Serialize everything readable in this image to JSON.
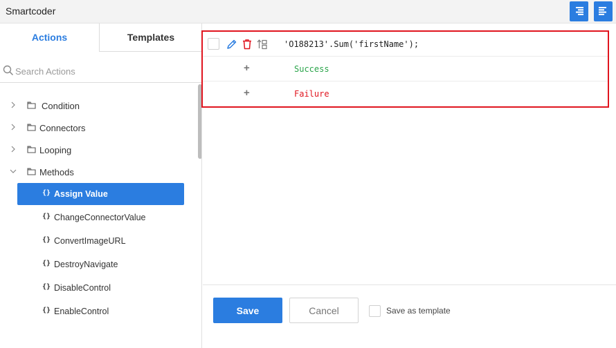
{
  "header": {
    "title": "Smartcoder",
    "buttons": [
      {
        "icon": "align-right-icon"
      },
      {
        "icon": "align-left-icon"
      }
    ]
  },
  "left_panel": {
    "tabs": [
      {
        "label": "Actions",
        "active": true
      },
      {
        "label": "Templates",
        "active": false
      }
    ],
    "search": {
      "placeholder": "Search Actions",
      "value": ""
    },
    "folders": [
      {
        "label": "Condition",
        "expanded": false
      },
      {
        "label": "Connectors",
        "expanded": false
      },
      {
        "label": "Looping",
        "expanded": false
      },
      {
        "label": "Methods",
        "expanded": true
      }
    ],
    "methods": [
      {
        "label": "Assign Value",
        "active": true
      },
      {
        "label": "ChangeConnectorValue",
        "active": false
      },
      {
        "label": "ConvertImageURL",
        "active": false
      },
      {
        "label": "DestroyNavigate",
        "active": false
      },
      {
        "label": "DisableControl",
        "active": false
      },
      {
        "label": "EnableControl",
        "active": false
      }
    ],
    "method_icon": "{}"
  },
  "code_block": {
    "statement": "'O188213'.Sum('firstName');",
    "success_label": "Success",
    "failure_label": "Failure",
    "plus": "+"
  },
  "footer": {
    "save_label": "Save",
    "cancel_label": "Cancel",
    "save_as_template_label": "Save as template"
  },
  "colors": {
    "accent": "#2b7de0",
    "success": "#2aa44a",
    "failure": "#e0141e",
    "highlight_border": "#e0141e"
  }
}
